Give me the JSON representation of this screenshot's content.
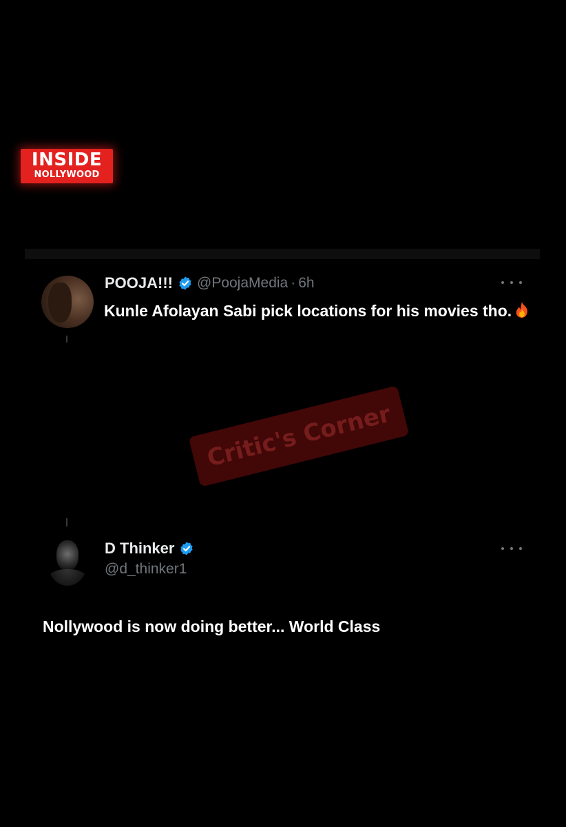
{
  "brand": {
    "logo_line1": "INSIDE",
    "logo_line2": "NOLLYWOOD",
    "accent_color": "#e3211f"
  },
  "watermark": {
    "text": "Critic's Corner",
    "color": "#7a1010"
  },
  "tweets": [
    {
      "display_name": "POOJA!!!",
      "verified": true,
      "handle": "@PoojaMedia",
      "separator": "·",
      "time": "6h",
      "text": "Kunle Afolayan Sabi pick locations for his movies tho.",
      "emoji_icon": "fire-icon",
      "more_icon": "more-options-icon"
    },
    {
      "display_name": "D Thinker",
      "verified": true,
      "handle": "@d_thinker1",
      "text": "Nollywood is now doing better... World Class",
      "more_icon": "more-options-icon"
    }
  ],
  "colors": {
    "background": "#000000",
    "secondary_text": "#71767b",
    "verified_blue": "#1d9bf0"
  }
}
